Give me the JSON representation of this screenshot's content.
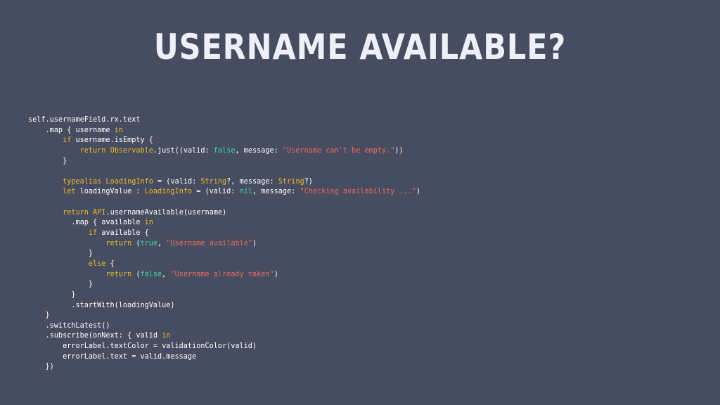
{
  "slide": {
    "title": "USERNAME AVAILABLE?"
  },
  "colors": {
    "background": "#464d60",
    "title": "#eef0f8",
    "plain": "#ffffff",
    "keyword": "#f0b92b",
    "literal": "#3cd6a7",
    "string": "#ee6b5c"
  },
  "code": {
    "language": "swift",
    "lines": [
      [
        [
          "plain",
          "self.usernameField.rx.text"
        ]
      ],
      [
        [
          "plain",
          "    .map { username "
        ],
        [
          "kw",
          "in"
        ]
      ],
      [
        [
          "plain",
          "        "
        ],
        [
          "kw",
          "if"
        ],
        [
          "plain",
          " username.isEmpty {"
        ]
      ],
      [
        [
          "plain",
          "            "
        ],
        [
          "kw",
          "return"
        ],
        [
          "plain",
          " "
        ],
        [
          "type",
          "Observable"
        ],
        [
          "plain",
          ".just((valid: "
        ],
        [
          "lit",
          "false"
        ],
        [
          "plain",
          ", message: "
        ],
        [
          "str",
          "\"Username can't be empty.\""
        ],
        [
          "plain",
          "))"
        ]
      ],
      [
        [
          "plain",
          "        }"
        ]
      ],
      [],
      [
        [
          "plain",
          "        "
        ],
        [
          "kw",
          "typealias"
        ],
        [
          "plain",
          " "
        ],
        [
          "type",
          "LoadingInfo"
        ],
        [
          "plain",
          " = (valid: "
        ],
        [
          "type",
          "String"
        ],
        [
          "plain",
          "?, message: "
        ],
        [
          "type",
          "String"
        ],
        [
          "plain",
          "?)"
        ]
      ],
      [
        [
          "plain",
          "        "
        ],
        [
          "kw",
          "let"
        ],
        [
          "plain",
          " loadingValue : "
        ],
        [
          "type",
          "LoadingInfo"
        ],
        [
          "plain",
          " = (valid: "
        ],
        [
          "lit",
          "nil"
        ],
        [
          "plain",
          ", message: "
        ],
        [
          "str",
          "\"Checking availability ...\""
        ],
        [
          "plain",
          ")"
        ]
      ],
      [],
      [
        [
          "plain",
          "        "
        ],
        [
          "kw",
          "return"
        ],
        [
          "plain",
          " "
        ],
        [
          "type",
          "API"
        ],
        [
          "plain",
          ".usernameAvailable(username)"
        ]
      ],
      [
        [
          "plain",
          "          .map { available "
        ],
        [
          "kw",
          "in"
        ]
      ],
      [
        [
          "plain",
          "              "
        ],
        [
          "kw",
          "if"
        ],
        [
          "plain",
          " available {"
        ]
      ],
      [
        [
          "plain",
          "                  "
        ],
        [
          "kw",
          "return"
        ],
        [
          "plain",
          " ("
        ],
        [
          "lit",
          "true"
        ],
        [
          "plain",
          ", "
        ],
        [
          "str",
          "\"Username available\""
        ],
        [
          "plain",
          ")"
        ]
      ],
      [
        [
          "plain",
          "              }"
        ]
      ],
      [
        [
          "plain",
          "              "
        ],
        [
          "kw",
          "else"
        ],
        [
          "plain",
          " {"
        ]
      ],
      [
        [
          "plain",
          "                  "
        ],
        [
          "kw",
          "return"
        ],
        [
          "plain",
          " ("
        ],
        [
          "lit",
          "false"
        ],
        [
          "plain",
          ", "
        ],
        [
          "str",
          "\"Username already taken\""
        ],
        [
          "plain",
          ")"
        ]
      ],
      [
        [
          "plain",
          "              }"
        ]
      ],
      [
        [
          "plain",
          "          }"
        ]
      ],
      [
        [
          "plain",
          "          .startWith(loadingValue)"
        ]
      ],
      [
        [
          "plain",
          "    }"
        ]
      ],
      [
        [
          "plain",
          "    .switchLatest()"
        ]
      ],
      [
        [
          "plain",
          "    .subscribe(onNext: { valid "
        ],
        [
          "kw",
          "in"
        ]
      ],
      [
        [
          "plain",
          "        errorLabel.textColor = validationColor(valid)"
        ]
      ],
      [
        [
          "plain",
          "        errorLabel.text = valid.message"
        ]
      ],
      [
        [
          "plain",
          "    })"
        ]
      ]
    ]
  }
}
